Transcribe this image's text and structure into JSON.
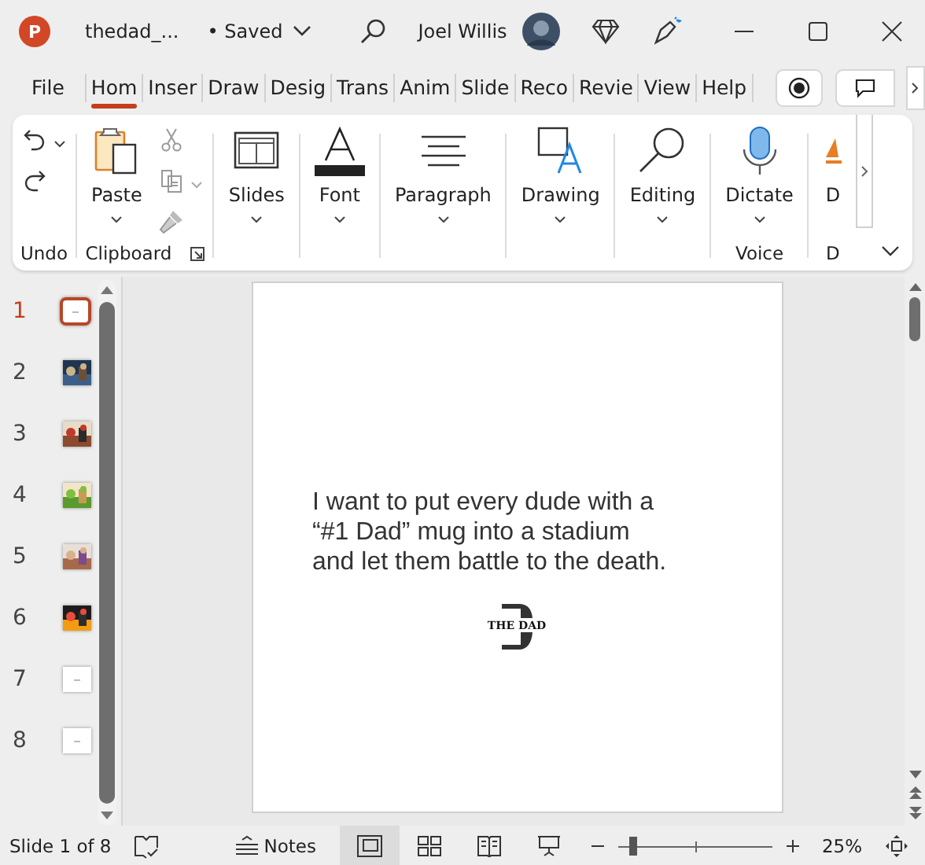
{
  "titlebar": {
    "app_logo": "P",
    "file_name": "thedad_...",
    "save_status": "• Saved",
    "user_name": "Joel Willis"
  },
  "tabs": [
    {
      "label": "File",
      "selected": false
    },
    {
      "label": "Hom",
      "selected": true
    },
    {
      "label": "Inser",
      "selected": false
    },
    {
      "label": "Draw",
      "selected": false
    },
    {
      "label": "Desig",
      "selected": false
    },
    {
      "label": "Trans",
      "selected": false
    },
    {
      "label": "Anim",
      "selected": false
    },
    {
      "label": "Slide",
      "selected": false
    },
    {
      "label": "Reco",
      "selected": false
    },
    {
      "label": "Revie",
      "selected": false
    },
    {
      "label": "View",
      "selected": false
    },
    {
      "label": "Help",
      "selected": false
    }
  ],
  "ribbon": {
    "groups": [
      {
        "label": "Undo",
        "controls": [
          {
            "kind": "stack",
            "items": [
              {
                "kind": "undo",
                "dropdown": true,
                "disabled": false
              },
              {
                "kind": "redo",
                "dropdown": false,
                "disabled": false
              }
            ]
          }
        ]
      },
      {
        "label": "Clipboard",
        "launcher": true,
        "controls": [
          {
            "kind": "paste",
            "label": "Paste",
            "dropdown": true
          },
          {
            "kind": "stack",
            "items": [
              {
                "kind": "cut",
                "dropdown": false,
                "disabled": true
              },
              {
                "kind": "copy",
                "dropdown": true,
                "disabled": true
              },
              {
                "kind": "painter",
                "dropdown": false,
                "disabled": true
              }
            ]
          }
        ]
      },
      {
        "controls": [
          {
            "kind": "slides",
            "label": "Slides",
            "dropdown": true
          }
        ]
      },
      {
        "controls": [
          {
            "kind": "font",
            "label": "Font",
            "dropdown": true
          }
        ]
      },
      {
        "controls": [
          {
            "kind": "paragraph",
            "label": "Paragraph",
            "dropdown": true
          }
        ]
      },
      {
        "controls": [
          {
            "kind": "drawing",
            "label": "Drawing",
            "dropdown": true
          }
        ]
      },
      {
        "controls": [
          {
            "kind": "editing",
            "label": "Editing",
            "dropdown": true
          }
        ]
      },
      {
        "label": "Voice",
        "controls": [
          {
            "kind": "dictate",
            "label": "Dictate",
            "dropdown": true
          }
        ]
      },
      {
        "label": "D",
        "controls": [
          {
            "kind": "designer",
            "label": "D",
            "dropdown": false
          }
        ]
      }
    ]
  },
  "slides": [
    {
      "number": "1",
      "selected": true,
      "kind": "blank"
    },
    {
      "number": "2",
      "selected": false,
      "kind": "picture"
    },
    {
      "number": "3",
      "selected": false,
      "kind": "picture"
    },
    {
      "number": "4",
      "selected": false,
      "kind": "picture"
    },
    {
      "number": "5",
      "selected": false,
      "kind": "picture"
    },
    {
      "number": "6",
      "selected": false,
      "kind": "picture"
    },
    {
      "number": "7",
      "selected": false,
      "kind": "blank"
    },
    {
      "number": "8",
      "selected": false,
      "kind": "blank"
    }
  ],
  "current_slide": {
    "text": "I want to put every dude with a\n“#1 Dad” mug into a stadium\nand let them battle to the death.",
    "logo": {
      "wordmark": "THE DAD"
    }
  },
  "status_bar": {
    "slide_counter": "Slide 1 of 8",
    "notes_label": "Notes",
    "views": [
      {
        "kind": "normal",
        "selected": true
      },
      {
        "kind": "sorter",
        "selected": false
      },
      {
        "kind": "reading",
        "selected": false
      },
      {
        "kind": "slideshow",
        "selected": false
      }
    ],
    "zoom": {
      "level": 0.1,
      "reading": "25%"
    }
  }
}
